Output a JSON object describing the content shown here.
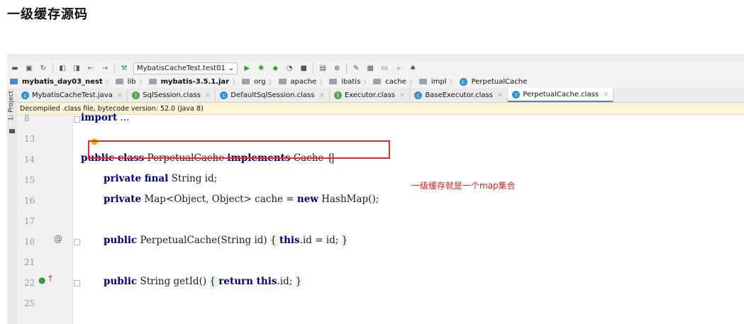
{
  "heading": "一级缓存源码",
  "toolbar": {
    "run_config": "MybatisCacheTest.test01"
  },
  "breadcrumb": [
    "mybatis_day03_nest",
    "lib",
    "mybatis-3.5.1.jar",
    "org",
    "apache",
    "ibatis",
    "cache",
    "impl",
    "PerpetualCache"
  ],
  "side_panel_label": "1: Project",
  "tabs": [
    {
      "label": "MybatisCacheTest.java",
      "badge": "C"
    },
    {
      "label": "SqlSession.class",
      "badge": "I"
    },
    {
      "label": "DefaultSqlSession.class",
      "badge": "C"
    },
    {
      "label": "Executor.class",
      "badge": "I"
    },
    {
      "label": "BaseExecutor.class",
      "badge": "C"
    },
    {
      "label": "PerpetualCache.class",
      "badge": "C",
      "active": true
    }
  ],
  "banner": "Decompiled .class file, bytecode version: 52.0 (Java 8)",
  "lines": [
    {
      "num": "8",
      "kw": "",
      "text": "import ..."
    },
    {
      "num": "13",
      "kw": "",
      "text": ""
    },
    {
      "num": "14",
      "text": "public class PerpetualCache implements Cache {"
    },
    {
      "num": "15",
      "text": "private final String id;"
    },
    {
      "num": "16",
      "text": "private Map<Object, Object> cache = new HashMap();"
    },
    {
      "num": "17",
      "text": ""
    },
    {
      "num": "18",
      "text": "public PerpetualCache(String id) { this.id = id; }"
    },
    {
      "num": "21",
      "text": ""
    },
    {
      "num": "22",
      "text": "public String getId() { return this.id; }"
    },
    {
      "num": "25",
      "text": ""
    }
  ],
  "annotation": "一级缓存就是一个map集合",
  "colors": {
    "annotation": "#e02020",
    "keyword": "#000080",
    "banner": "#fcf6d8"
  }
}
